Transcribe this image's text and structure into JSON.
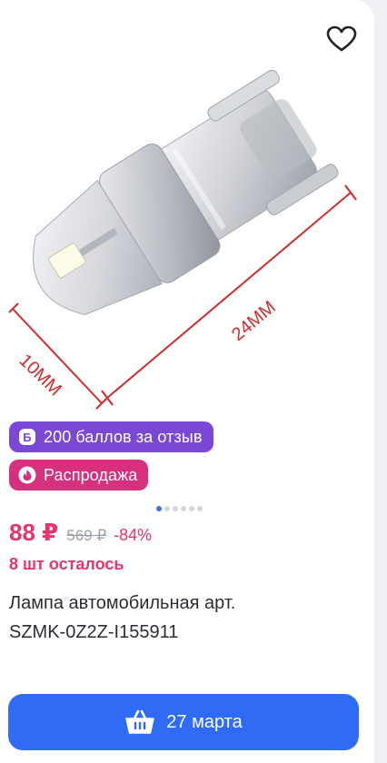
{
  "product": {
    "image": {
      "length_label": "24MM",
      "diameter_label": "10MM"
    },
    "favorite_icon": "heart-outline-icon",
    "badges": {
      "bonus": {
        "icon": "bonus-b-icon",
        "label": "200 баллов за отзыв",
        "color": "#7b48d6"
      },
      "sale": {
        "icon": "flame-icon",
        "label": "Распродажа",
        "color": "#d6307e"
      }
    },
    "gallery": {
      "total_images": 6,
      "active_index": 0
    },
    "price": {
      "current": "88 ₽",
      "old": "569 ₽",
      "discount": "-84%"
    },
    "stock": "8 шт осталось",
    "title_line1": "Лампа автомобильная арт.",
    "title_line2": "SZMK-0Z2Z-I155911",
    "buy_button": {
      "icon": "basket-icon",
      "label": "27 марта",
      "color": "#2f6bf5"
    }
  },
  "colors": {
    "accent_pink": "#e8336d",
    "old_price_gray": "#9aa0a8",
    "dimension_red": "#d42a2a"
  }
}
